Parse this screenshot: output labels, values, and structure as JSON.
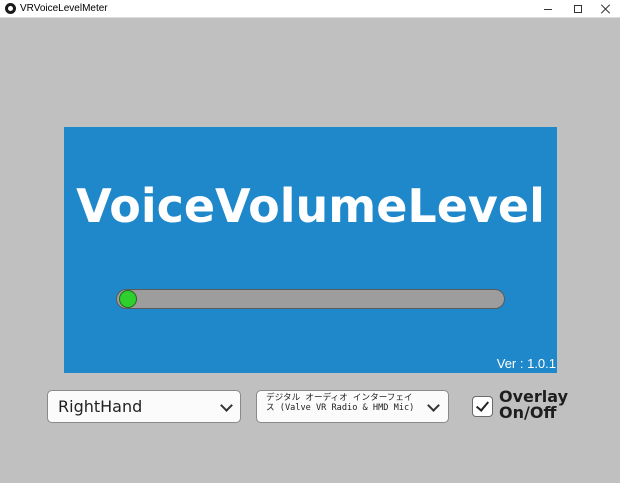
{
  "window": {
    "title": "VRVoiceLevelMeter",
    "controls": [
      "minimize",
      "maximize",
      "close"
    ]
  },
  "panel": {
    "title": "VoiceVolumeLevel",
    "background_color": "#1f88ca",
    "meter": {
      "level": 0.0,
      "indicator_color": "#2ecf2e",
      "track_color": "#9d9d9d"
    },
    "version": "Ver : 1.0.1"
  },
  "controls": {
    "hand_select": {
      "value": "RightHand",
      "icon": "chevron-down-icon"
    },
    "device_select": {
      "value": "デジタル オーディオ インターフェイス (Valve VR Radio & HMD Mic)",
      "icon": "chevron-down-icon"
    },
    "overlay_toggle": {
      "checked": true,
      "label_line1": "Overlay",
      "label_line2": "On/Off"
    }
  }
}
